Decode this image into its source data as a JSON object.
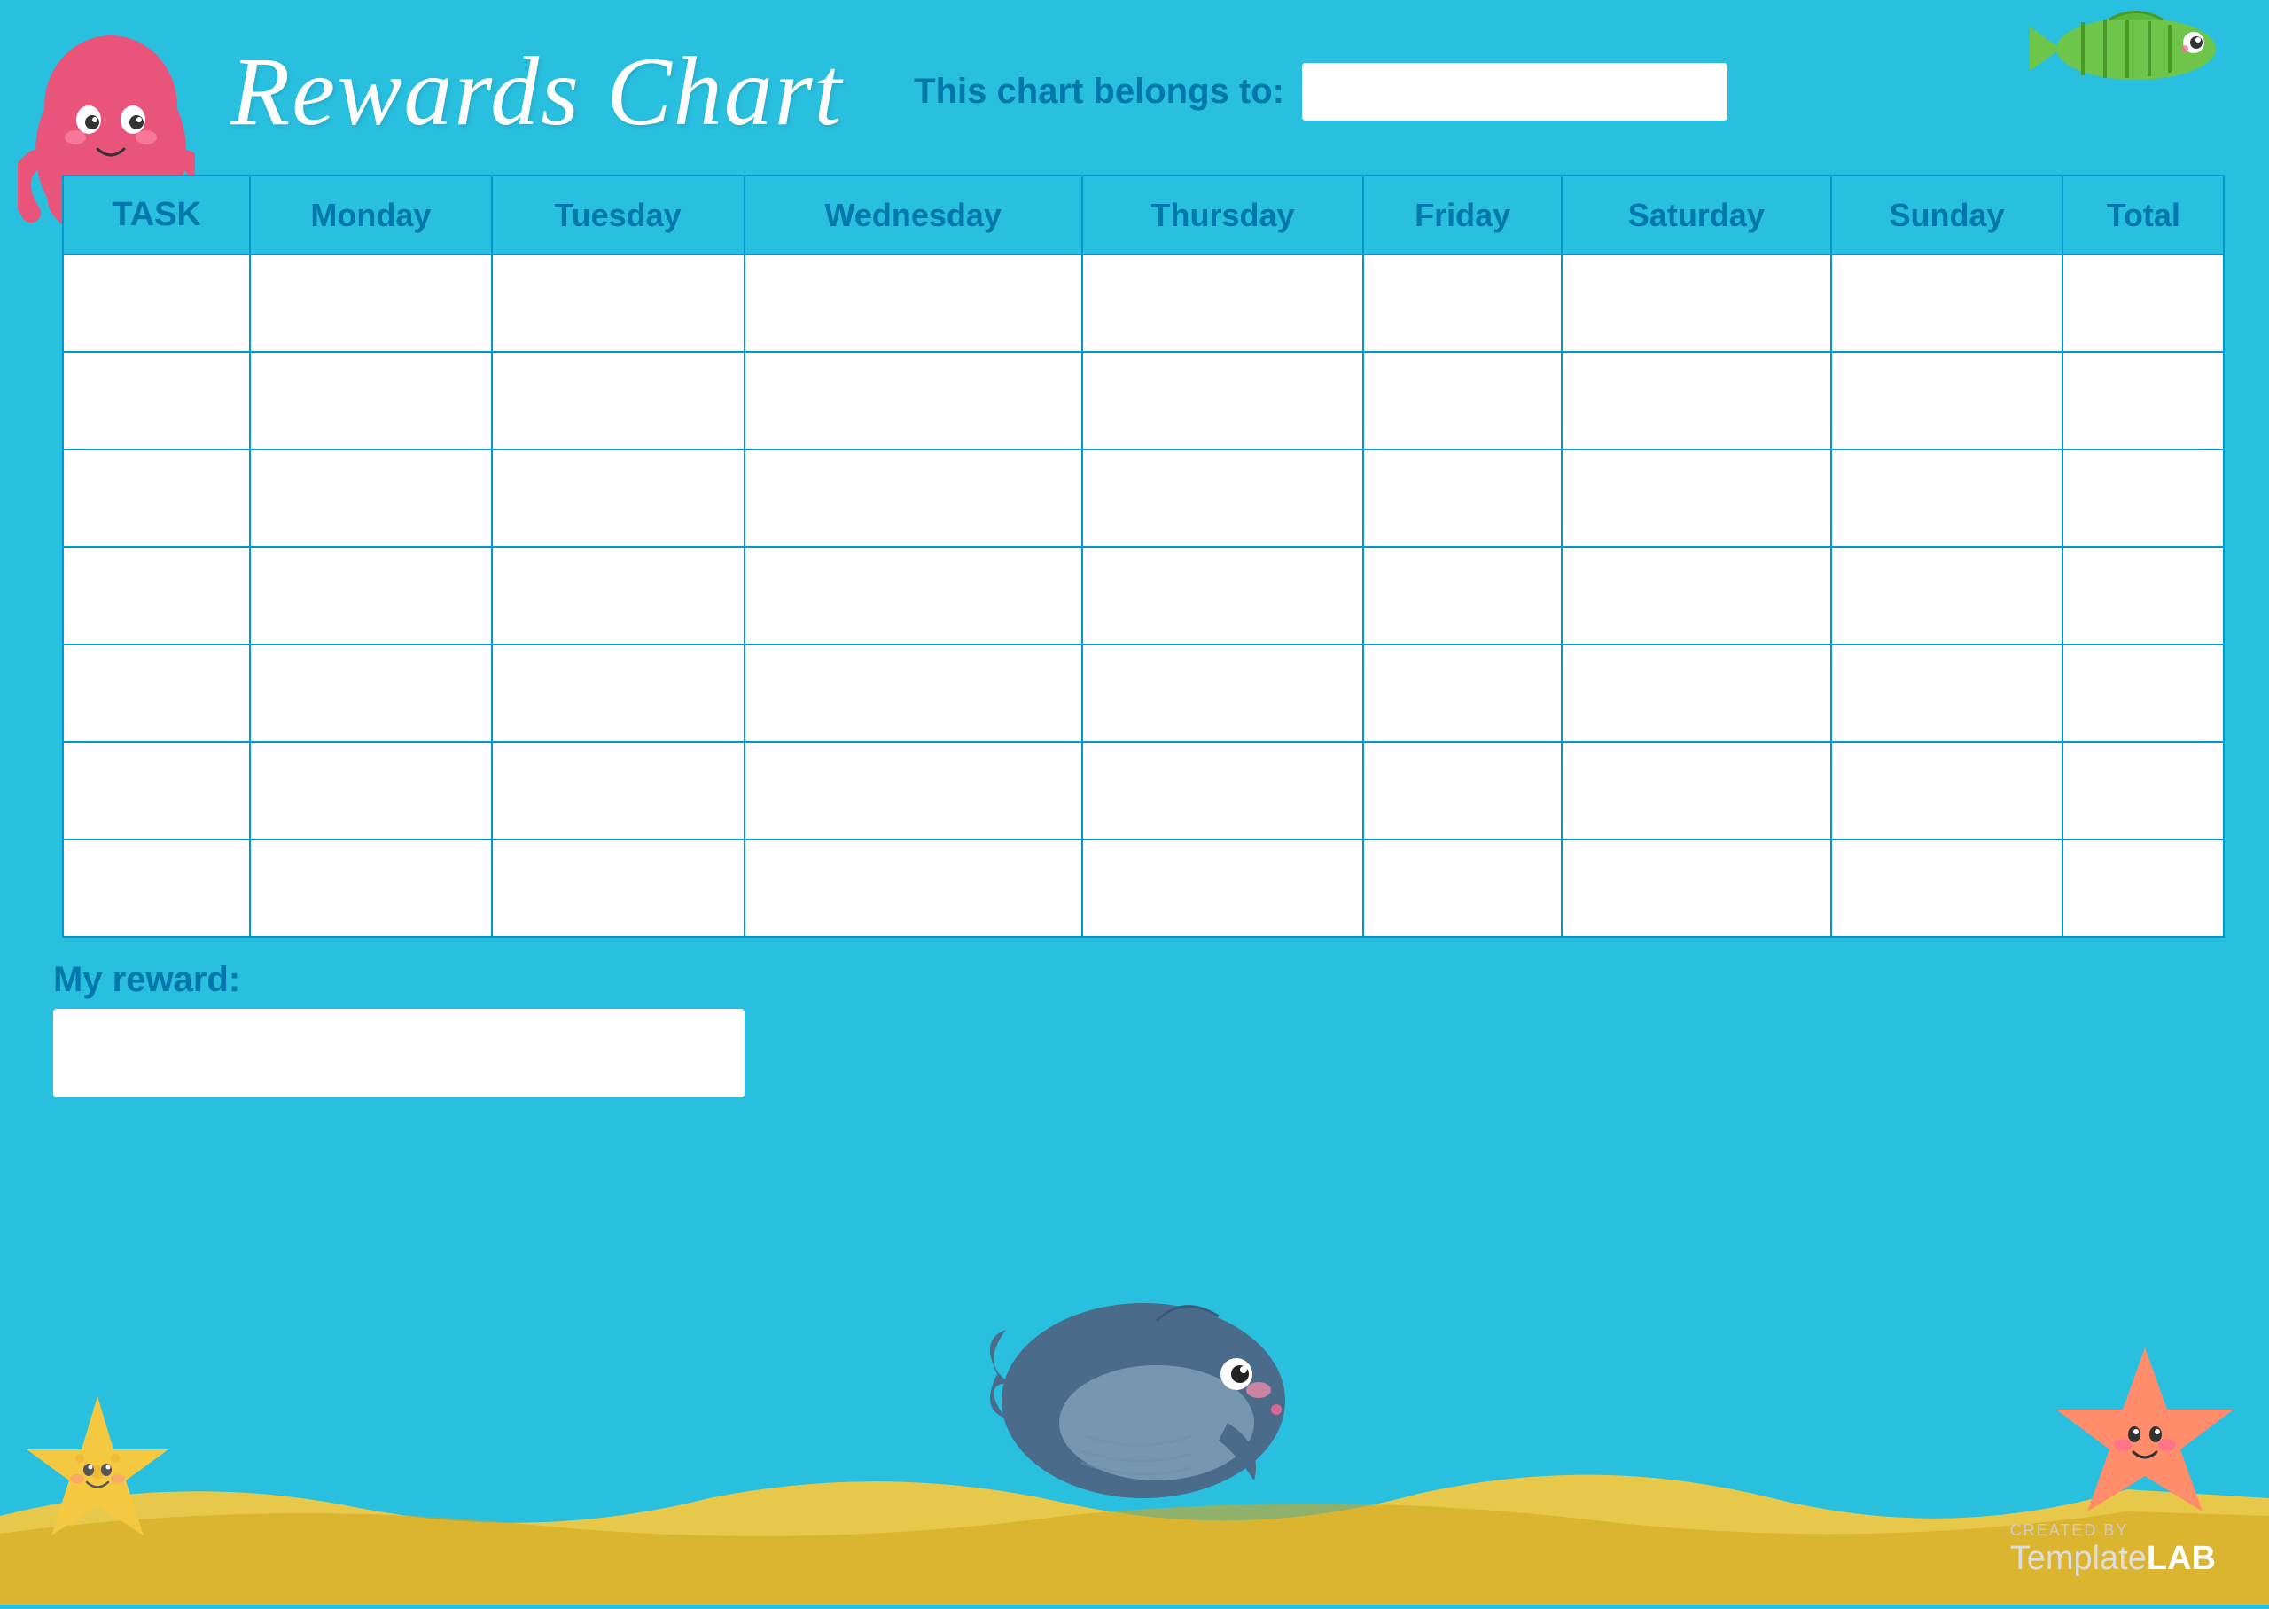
{
  "title": "Rewards Chart",
  "belongs_to_label": "This chart belongs to:",
  "belongs_to_placeholder": "",
  "columns": [
    "TASK",
    "Monday",
    "Tuesday",
    "Wednesday",
    "Thursday",
    "Friday",
    "Saturday",
    "Sunday",
    "Total"
  ],
  "rows": 7,
  "my_reward_label": "My reward:",
  "my_reward_placeholder": "",
  "brand": {
    "created_by": "CREATED BY",
    "template": "Template",
    "lab": "LAB"
  },
  "colors": {
    "background": "#29BFDF",
    "text_header": "#0077AA",
    "border": "#0099CC",
    "cell_bg": "#FFFFFF",
    "title": "#FFFFFF",
    "sand": "#E8C84A"
  }
}
